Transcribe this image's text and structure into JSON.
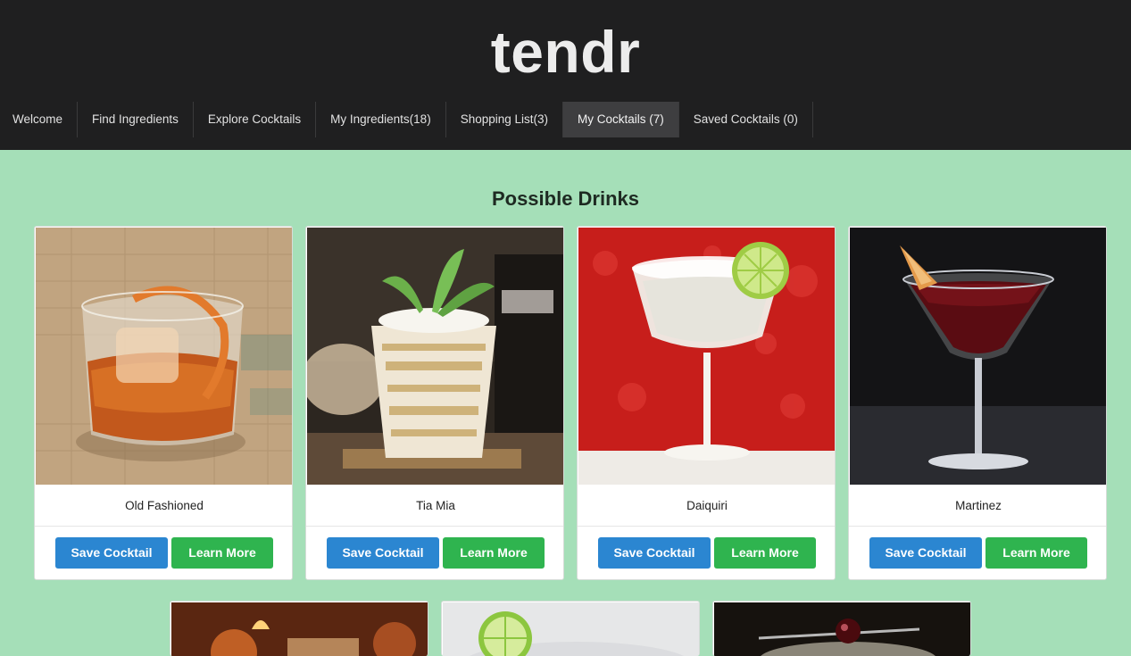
{
  "header": {
    "brand": "tendr"
  },
  "nav": [
    {
      "label": "Welcome",
      "active": false
    },
    {
      "label": "Find Ingredients",
      "active": false
    },
    {
      "label": "Explore Cocktails",
      "active": false
    },
    {
      "label": "My Ingredients(18)",
      "active": false
    },
    {
      "label": "Shopping List(3)",
      "active": false
    },
    {
      "label": "My Cocktails (7)",
      "active": true
    },
    {
      "label": "Saved Cocktails (0)",
      "active": false
    }
  ],
  "main": {
    "title": "Possible Drinks",
    "save_label": "Save Cocktail",
    "learn_label": "Learn More",
    "drinks": [
      {
        "name": "Old Fashioned",
        "image": "old-fashioned-photo"
      },
      {
        "name": "Tia Mia",
        "image": "tia-mia-photo"
      },
      {
        "name": "Daiquiri",
        "image": "daiquiri-photo"
      },
      {
        "name": "Martinez",
        "image": "martinez-photo"
      }
    ]
  },
  "colors": {
    "header_bg": "#1f1f20",
    "page_bg": "#a5dfb8",
    "save_button": "#2b86d1",
    "learn_button": "#2fb44f"
  }
}
